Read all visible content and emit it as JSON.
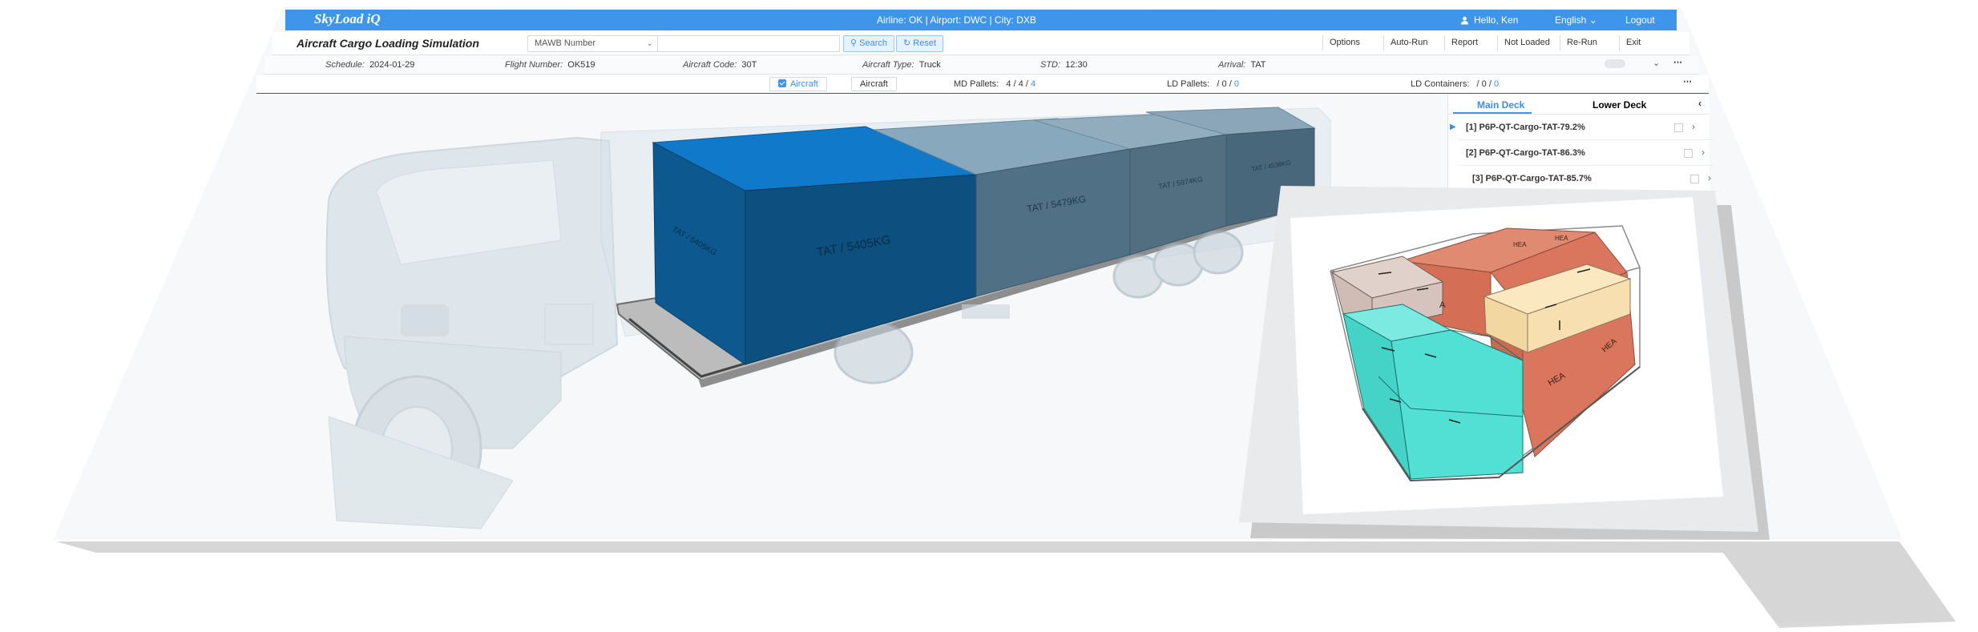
{
  "header": {
    "logo": "SkyLoad iQ",
    "airline_info": "Airline: OK  |  Airport: DWC  |  City: DXB",
    "user_greeting": "Hello, Ken",
    "language": "English",
    "logout": "Logout"
  },
  "toolbar": {
    "app_title": "Aircraft Cargo Loading Simulation",
    "mawb_select": "MAWB Number",
    "search_button": "Search",
    "reset_button": "Reset",
    "options": "Options",
    "auto_run": "Auto-Run",
    "report": "Report",
    "not_loaded": "Not Loaded",
    "re_run": "Re-Run",
    "exit": "Exit"
  },
  "flight": {
    "schedule_label": "Schedule:",
    "schedule_value": "2024-01-29",
    "flight_number_label": "Flight Number:",
    "flight_number_value": "OK519",
    "aircraft_code_label": "Aircraft Code:",
    "aircraft_code_value": "30T",
    "aircraft_type_label": "Aircraft Type:",
    "aircraft_type_value": "Truck",
    "std_label": "STD:",
    "std_value": "12:30",
    "arrival_label": "Arrival:",
    "arrival_value": "TAT"
  },
  "view_bar": {
    "aircraft_checkbox_label": "Aircraft",
    "aircraft_button": "Aircraft",
    "md_pallets_label": "MD Pallets:",
    "md_pallets_a": "4",
    "md_pallets_sep1": "/",
    "md_pallets_b": "4",
    "md_pallets_sep2": "/",
    "md_pallets_c": "4",
    "ld_pallets_label": "LD Pallets:",
    "ld_pallets_a": "/",
    "ld_pallets_b": "0",
    "ld_pallets_sep": "/",
    "ld_pallets_c": "0",
    "ld_containers_label": "LD Containers:",
    "ld_containers_a": "/",
    "ld_containers_b": "0",
    "ld_containers_sep": "/",
    "ld_containers_c": "0"
  },
  "side_panel": {
    "tab_main": "Main Deck",
    "tab_lower": "Lower Deck",
    "items": [
      {
        "label": "[1]  P6P-QT-Cargo-TAT-79.2%"
      },
      {
        "label": "[2]  P6P-QT-Cargo-TAT-86.3%"
      },
      {
        "label": "[3]  P6P-QT-Cargo-TAT-85.7%"
      }
    ]
  },
  "scene": {
    "pallet_labels": [
      "TAT / 5405KG",
      "TAT / 5479KG",
      "TAT / 5974KG",
      "TAT / 4538KG",
      "TAT / 5405KG"
    ],
    "box_labels": [
      "HEA",
      "HEA",
      "HEA",
      "HEA",
      "A"
    ],
    "colors": {
      "pallet_front": "#0d4f7e",
      "pallet_top": "#1179c9",
      "pallet_gray": "#4f7085",
      "box_red": "#d9765d",
      "box_cyan": "#52e0d5",
      "box_cream": "#f7dfb2",
      "box_tan": "#d6c3bd",
      "header_blue": "#3f95ea"
    }
  }
}
